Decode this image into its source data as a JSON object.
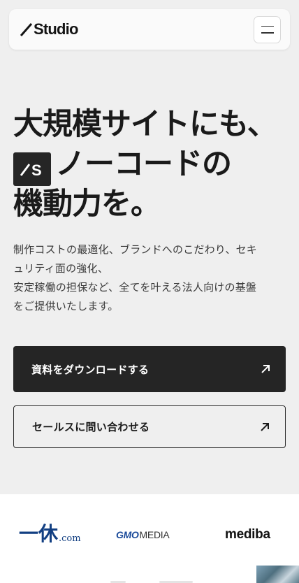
{
  "header": {
    "logo_text": "Studio",
    "menu_icon": "hamburger-menu-icon"
  },
  "hero": {
    "title_line1": "大規模サイトにも、",
    "title_badge": "S",
    "title_line2": "ノーコードの",
    "title_line3": "機動力を。",
    "desc_line1": "制作コストの最適化、ブランドへのこだわり、セキ",
    "desc_line2": "ュリティ面の強化、",
    "desc_line3": "安定稼働の担保など、全てを叶える法人向けの基盤",
    "desc_line4": "をご提供いたします。"
  },
  "buttons": {
    "download_label": "資料をダウンロードする",
    "contact_label": "セールスに問い合わせる",
    "arrow_icon": "arrow-up-right-icon"
  },
  "logos": {
    "ikyu_kanji": "一休",
    "ikyu_suffix": ".com",
    "gmo_bold": "GMO",
    "gmo_light": "MEDIA",
    "mediba": "mediba"
  },
  "colors": {
    "background": "#efefef",
    "header_bg": "#fafafa",
    "primary_button": "#252525",
    "ikyu_blue": "#123f82",
    "gmo_blue": "#1a4a9a"
  }
}
